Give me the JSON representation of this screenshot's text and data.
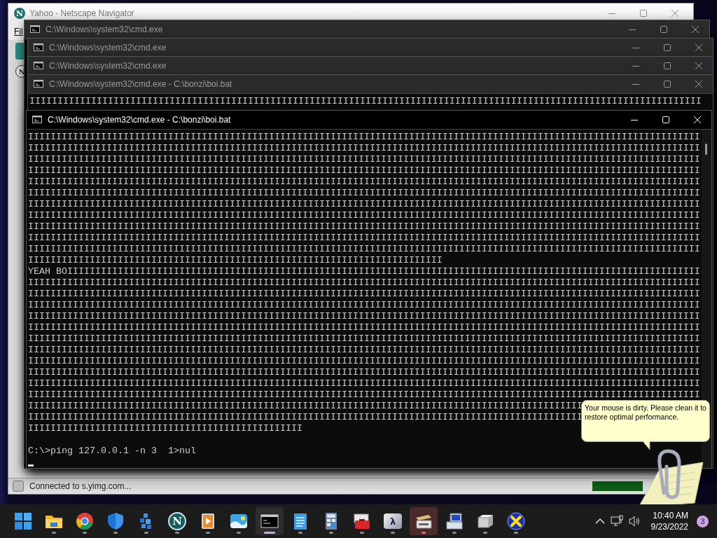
{
  "browser_window": {
    "title": "Yahoo - Netscape Navigator",
    "logo_glyph": "N",
    "menu": [
      "Fil"
    ],
    "throbber_glyph": "N",
    "status_text": "Connected to s.yimg.com...",
    "progress": {
      "level": 1
    }
  },
  "console_windows": [
    {
      "title": "C:\\Windows\\system32\\cmd.exe",
      "active": false
    },
    {
      "title": "C:\\Windows\\system32\\cmd.exe",
      "active": false
    },
    {
      "title": "C:\\Windows\\system32\\cmd.exe",
      "active": false
    },
    {
      "title": "C:\\Windows\\system32\\cmd.exe - C:\\bonzi\\boi.bat",
      "active": false,
      "lines": [
        "IIIIIIIIIIIIIIIIIIIIIIIIIIIIIIIIIIIIIIIIIIIIIIIIIIIIIIIIIIIIIIIIIIIIIIIIIIIIIIIIIIIIIIIIIIIIIIIIIIIIIIIIIIIIIIIIIIIIIIII"
      ]
    },
    {
      "title": "C:\\Windows\\system32\\cmd.exe - C:\\bonzi\\boi.bat",
      "active": true,
      "lines": [
        "IIIIIIIIIIIIIIIIIIIIIIIIIIIIIIIIIIIIIIIIIIIIIIIIIIIIIIIIIIIIIIIIIIIIIIIIIIIIIIIIIIIIIIIIIIIIIIIIIIIIIIIIIIIIIIIIIIIIIIII",
        "IIIIIIIIIIIIIIIIIIIIIIIIIIIIIIIIIIIIIIIIIIIIIIIIIIIIIIIIIIIIIIIIIIIIIIIIIIIIIIIIIIIIIIIIIIIIIIIIIIIIIIIIIIIIIIIIIIIIIIII",
        "IIIIIIIIIIIIIIIIIIIIIIIIIIIIIIIIIIIIIIIIIIIIIIIIIIIIIIIIIIIIIIIIIIIIIIIIIIIIIIIIIIIIIIIIIIIIIIIIIIIIIIIIIIIIIIIIIIIIIIII",
        "IIIIIIIIIIIIIIIIIIIIIIIIIIIIIIIIIIIIIIIIIIIIIIIIIIIIIIIIIIIIIIIIIIIIIIIIIIIIIIIIIIIIIIIIIIIIIIIIIIIIIIIIIIIIIIIIIIIIIIII",
        "IIIIIIIIIIIIIIIIIIIIIIIIIIIIIIIIIIIIIIIIIIIIIIIIIIIIIIIIIIIIIIIIIIIIIIIIIIIIIIIIIIIIIIIIIIIIIIIIIIIIIIIIIIIIIIIIIIIIIIII",
        "IIIIIIIIIIIIIIIIIIIIIIIIIIIIIIIIIIIIIIIIIIIIIIIIIIIIIIIIIIIIIIIIIIIIIIIIIIIIIIIIIIIIIIIIIIIIIIIIIIIIIIIIIIIIIIIIIIIIIIII",
        "IIIIIIIIIIIIIIIIIIIIIIIIIIIIIIIIIIIIIIIIIIIIIIIIIIIIIIIIIIIIIIIIIIIIIIIIIIIIIIIIIIIIIIIIIIIIIIIIIIIIIIIIIIIIIIIIIIIIIIII",
        "IIIIIIIIIIIIIIIIIIIIIIIIIIIIIIIIIIIIIIIIIIIIIIIIIIIIIIIIIIIIIIIIIIIIIIIIIIIIIIIIIIIIIIIIIIIIIIIIIIIIIIIIIIIIIIIIIIIIIIII",
        "IIIIIIIIIIIIIIIIIIIIIIIIIIIIIIIIIIIIIIIIIIIIIIIIIIIIIIIIIIIIIIIIIIIIIIIIIIIIIIIIIIIIIIIIIIIIIIIIIIIIIIIIIIIIIIIIIIIIIIII",
        "IIIIIIIIIIIIIIIIIIIIIIIIIIIIIIIIIIIIIIIIIIIIIIIIIIIIIIIIIIIIIIIIIIIIIIIIIIIIIIIIIIIIIIIIIIIIIIIIIIIIIIIIIIIIIIIIIIIIIIII",
        "IIIIIIIIIIIIIIIIIIIIIIIIIIIIIIIIIIIIIIIIIIIIIIIIIIIIIIIIIIIIIIIIIIIIIIIIIIIIIIIIIIIIIIIIIIIIIIIIIIIIIIIIIIIIIIIIIIIIIIII",
        "IIIIIIIIIIIIIIIIIIIIIIIIIIIIIIIIIIIIIIIIIIIIIIIIIIIIIIIIIIIIIIIIIIIIIIIIII",
        "YEAH BOIIIIIIIIIIIIIIIIIIIIIIIIIIIIIIIIIIIIIIIIIIIIIIIIIIIIIIIIIIIIIIIIIIIIIIIIIIIIIIIIIIIIIIIIIIIIIIIIIIIIIIIIIIIIIIIII",
        "IIIIIIIIIIIIIIIIIIIIIIIIIIIIIIIIIIIIIIIIIIIIIIIIIIIIIIIIIIIIIIIIIIIIIIIIIIIIIIIIIIIIIIIIIIIIIIIIIIIIIIIIIIIIIIIIIIIIIIII",
        "IIIIIIIIIIIIIIIIIIIIIIIIIIIIIIIIIIIIIIIIIIIIIIIIIIIIIIIIIIIIIIIIIIIIIIIIIIIIIIIIIIIIIIIIIIIIIIIIIIIIIIIIIIIIIIIIIIIIIIII",
        "IIIIIIIIIIIIIIIIIIIIIIIIIIIIIIIIIIIIIIIIIIIIIIIIIIIIIIIIIIIIIIIIIIIIIIIIIIIIIIIIIIIIIIIIIIIIIIIIIIIIIIIIIIIIIIIIIIIIIIII",
        "IIIIIIIIIIIIIIIIIIIIIIIIIIIIIIIIIIIIIIIIIIIIIIIIIIIIIIIIIIIIIIIIIIIIIIIIIIIIIIIIIIIIIIIIIIIIIIIIIIIIIIIIIIIIIIIIIIIIIIII",
        "IIIIIIIIIIIIIIIIIIIIIIIIIIIIIIIIIIIIIIIIIIIIIIIIIIIIIIIIIIIIIIIIIIIIIIIIIIIIIIIIIIIIIIIIIIIIIIIIIIIIIIIIIIIIIIIIIIIIIIII",
        "IIIIIIIIIIIIIIIIIIIIIIIIIIIIIIIIIIIIIIIIIIIIIIIIIIIIIIIIIIIIIIIIIIIIIIIIIIIIIIIIIIIIIIIIIIIIIIIIIIIIIIIIIIIIIIIIIIIIIIII",
        "IIIIIIIIIIIIIIIIIIIIIIIIIIIIIIIIIIIIIIIIIIIIIIIIIIIIIIIIIIIIIIIIIIIIIIIIIIIIIIIIIIIIIIIIIIIIIIIIIIIIIIIIIIIIIIIIIIIIIIII",
        "IIIIIIIIIIIIIIIIIIIIIIIIIIIIIIIIIIIIIIIIIIIIIIIIIIIIIIIIIIIIIIIIIIIIIIIIIIIIIIIIIIIIIIIIIIIIIIIIIIIIIIIIIIIIIIIIIIIIIIII",
        "IIIIIIIIIIIIIIIIIIIIIIIIIIIIIIIIIIIIIIIIIIIIIIIIIIIIIIIIIIIIIIIIIIIIIIIIIIIIIIIIIIIIIIIIIIIIIIIIIIIIIIIIIIIIIIIIIIIIIIII",
        "IIIIIIIIIIIIIIIIIIIIIIIIIIIIIIIIIIIIIIIIIIIIIIIIIIIIIIIIIIIIIIIIIIIIIIIIIIIIIIIIIIIIIIIIIIIIIIIIIIIIIIIIIIIIIIIIIIIIIIII",
        "IIIIIIIIIIIIIIIIIIIIIIIIIIIIIIIIIIIIIIIIIIIIIIIIIIIIIIIIIIIIIIIIIIIIIIIIIIIIIIIIIIIIIIIIIIIIIIIIIIIIIIIIIIIIIIIIIIIIIIII",
        "IIIIIIIIIIIIIIIIIIIIIIIIIIIIIIIIIIIIIIIIIIIIIIIIIIIIIIIIIIIIIIIIIIIIIIIIIIIIIIIIIIIIIIIIIIIIIIIIIII",
        "IIIIIIIIIIIIIIIIIIIIIIIIIIIIIIIIIIIIIIIIIIIIIIIIIIIIIIIIIIIIIIIIIIIIIIIIIIIIIIIIIIIIIIIIIIIIIIIIIII",
        "IIIIIIIIIIIIIIIIIIIIIIIIIIIIIIIIIIIIIIIIIIIIIIIII"
      ],
      "prompt": "C:\\>ping 127.0.0.1 -n 3  1>nul"
    }
  ],
  "balloon": {
    "text": "Your mouse is dirty. Please clean it to restore optimal performance."
  },
  "taskbar": {
    "apps": [
      {
        "kind": "start",
        "running": false,
        "selected": false,
        "attention": false
      },
      {
        "kind": "folder",
        "running": true,
        "selected": false,
        "attention": false
      },
      {
        "kind": "browser",
        "running": true,
        "selected": false,
        "attention": false
      },
      {
        "kind": "shield",
        "running": true,
        "selected": false,
        "attention": false
      },
      {
        "kind": "cubes",
        "running": true,
        "selected": false,
        "attention": false
      },
      {
        "kind": "netscape",
        "glyph": "N",
        "running": true,
        "selected": false,
        "attention": false
      },
      {
        "kind": "media",
        "running": true,
        "selected": false,
        "attention": false
      },
      {
        "kind": "photos",
        "running": true,
        "selected": false,
        "attention": false
      },
      {
        "kind": "terminal",
        "running": true,
        "selected": true,
        "attention": false
      },
      {
        "kind": "notepad",
        "running": true,
        "selected": false,
        "attention": false
      },
      {
        "kind": "calculator",
        "running": true,
        "selected": false,
        "attention": false
      },
      {
        "kind": "toolbox",
        "running": true,
        "selected": false,
        "attention": false
      },
      {
        "kind": "cube",
        "glyph": "λ",
        "running": true,
        "selected": false,
        "attention": false
      },
      {
        "kind": "scanner",
        "running": true,
        "selected": false,
        "attention": true
      },
      {
        "kind": "computer",
        "running": true,
        "selected": false,
        "attention": false
      },
      {
        "kind": "drive",
        "running": true,
        "selected": false,
        "attention": false
      },
      {
        "kind": "cross",
        "running": true,
        "selected": false,
        "attention": false
      }
    ],
    "time": "10:40 AM",
    "date": "9/23/2022",
    "notification_count": "3"
  }
}
